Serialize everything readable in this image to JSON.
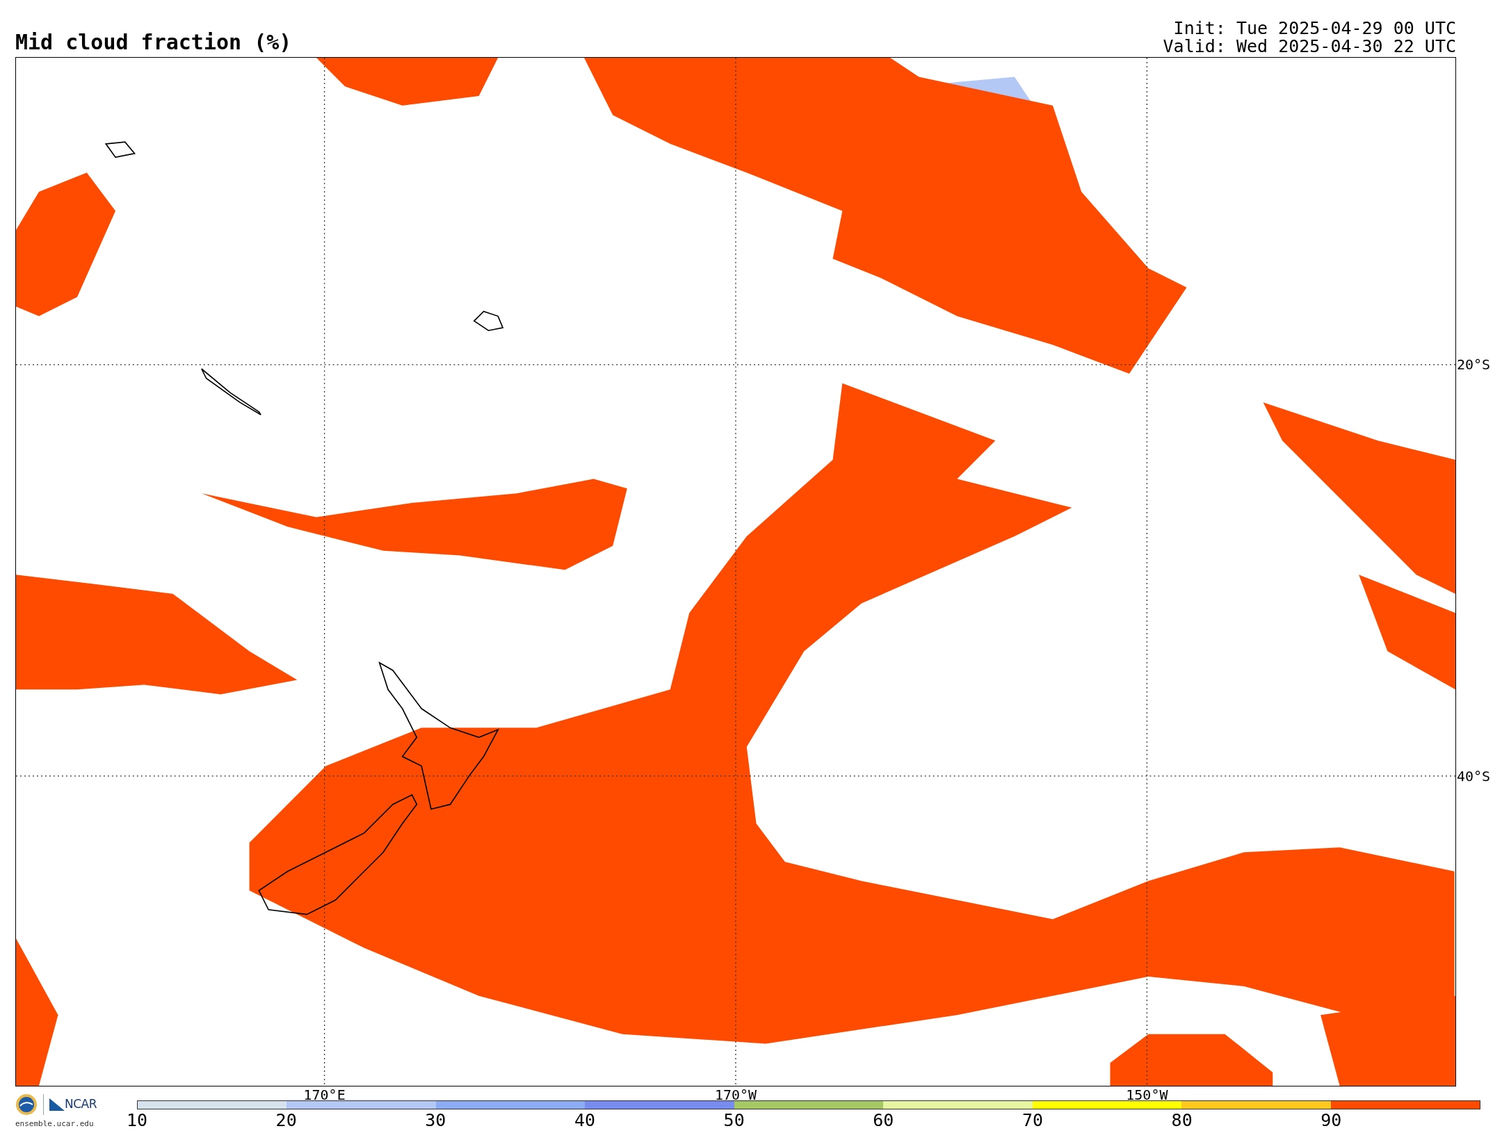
{
  "title": "Mid cloud fraction (%)",
  "run_info": [
    "Init: Tue 2025-04-29 00 UTC",
    "Valid: Wed 2025-04-30 22 UTC"
  ],
  "map": {
    "longitude_labels": [
      "170°E",
      "170°W",
      "150°W"
    ],
    "latitude_labels": [
      "20°S",
      "40°S"
    ]
  },
  "logo": {
    "name": "NCAR",
    "site": "ensemble.ucar.edu"
  },
  "colorbar": {
    "bins": [
      {
        "color": "#d6e2ed"
      },
      {
        "color": "#b4c8f5"
      },
      {
        "color": "#8cacf5"
      },
      {
        "color": "#788cf0"
      },
      {
        "color": "#a6c864"
      },
      {
        "color": "#e6f5a0"
      },
      {
        "color": "#ffff00"
      },
      {
        "color": "#ffc81e"
      },
      {
        "color": "#ff4b00"
      }
    ],
    "ticks": [
      "10",
      "20",
      "30",
      "40",
      "50",
      "60",
      "70",
      "80",
      "90"
    ]
  }
}
